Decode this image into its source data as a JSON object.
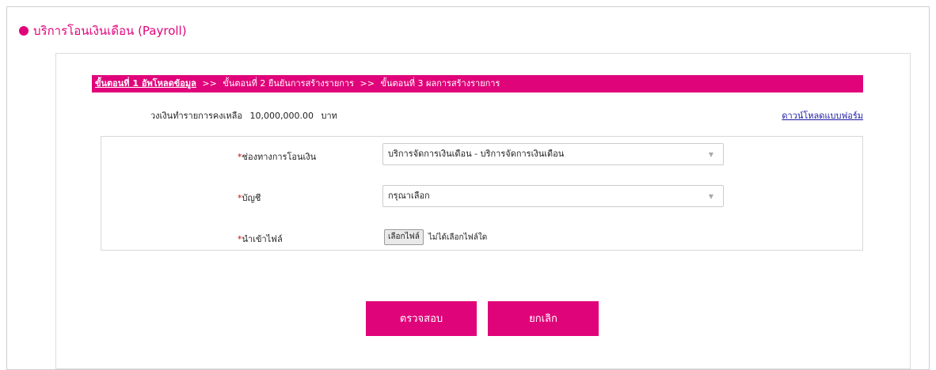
{
  "page": {
    "title": "บริการโอนเงินเดือน (Payroll)"
  },
  "steps": {
    "step1": "ขั้นตอนที่ 1 อัพโหลดข้อมูล",
    "separator1": ">>",
    "step2": "ขั้นตอนที่ 2 ยืนยันการสร้างรายการ",
    "separator2": ">>",
    "step3": "ขั้นตอนที่ 3 ผลการสร้างรายการ"
  },
  "limit": {
    "label": "วงเงินทำรายการคงเหลือ",
    "amount": "10,000,000.00",
    "unit": "บาท"
  },
  "download_link": "ดาวน์โหลดแบบฟอร์ม",
  "form": {
    "channel": {
      "required_mark": "*",
      "label": "ช่องทางการโอนเงิน",
      "selected": "บริการจัดการเงินเดือน - บริการจัดการเงินเดือน"
    },
    "account": {
      "required_mark": "*",
      "label": "บัญชี",
      "selected": "กรุณาเลือก"
    },
    "file": {
      "required_mark": "*",
      "label": "นำเข้าไฟล์",
      "button": "เลือกไฟล์",
      "status": "ไม่ได้เลือกไฟล์ใด"
    }
  },
  "buttons": {
    "check": "ตรวจสอบ",
    "cancel": "ยกเลิก"
  },
  "colors": {
    "accent": "#e0047a",
    "required": "#e00000",
    "link": "#1a1aa8"
  },
  "icons": {
    "dropdown": "triangle-down"
  }
}
